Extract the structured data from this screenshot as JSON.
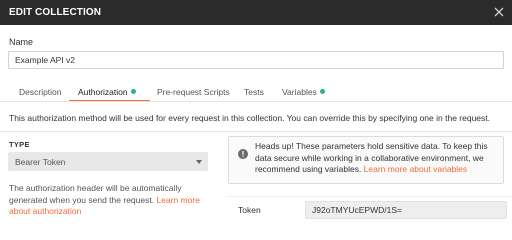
{
  "window": {
    "title": "EDIT COLLECTION",
    "close_icon": "close-icon"
  },
  "name_field": {
    "label": "Name",
    "value": "Example API v2"
  },
  "tabs": [
    {
      "label": "Description",
      "active": false,
      "indicator": false
    },
    {
      "label": "Authorization",
      "active": true,
      "indicator": true
    },
    {
      "label": "Pre-request Scripts",
      "active": false,
      "indicator": false
    },
    {
      "label": "Tests",
      "active": false,
      "indicator": false
    },
    {
      "label": "Variables",
      "active": false,
      "indicator": true
    }
  ],
  "colors": {
    "accent": "#f26b3a",
    "indicator_dot": "#26b47f",
    "titlebar": "#2b2b2b"
  },
  "authorization": {
    "description": "This authorization method will be used for every request in this collection. You can override this by specifying one in the request.",
    "type_label": "TYPE",
    "type_value": "Bearer Token",
    "help_text": "The authorization header will be automatically generated when you send the request. ",
    "help_link": "Learn more about authorization",
    "notice_text": "Heads up! These parameters hold sensitive data. To keep this data secure while working in a collaborative environment, we recommend using variables. ",
    "notice_link": "Learn more about variables",
    "notice_icon": "info-icon",
    "token_label": "Token",
    "token_value": "J92oTMYUcEPWD/1S="
  }
}
